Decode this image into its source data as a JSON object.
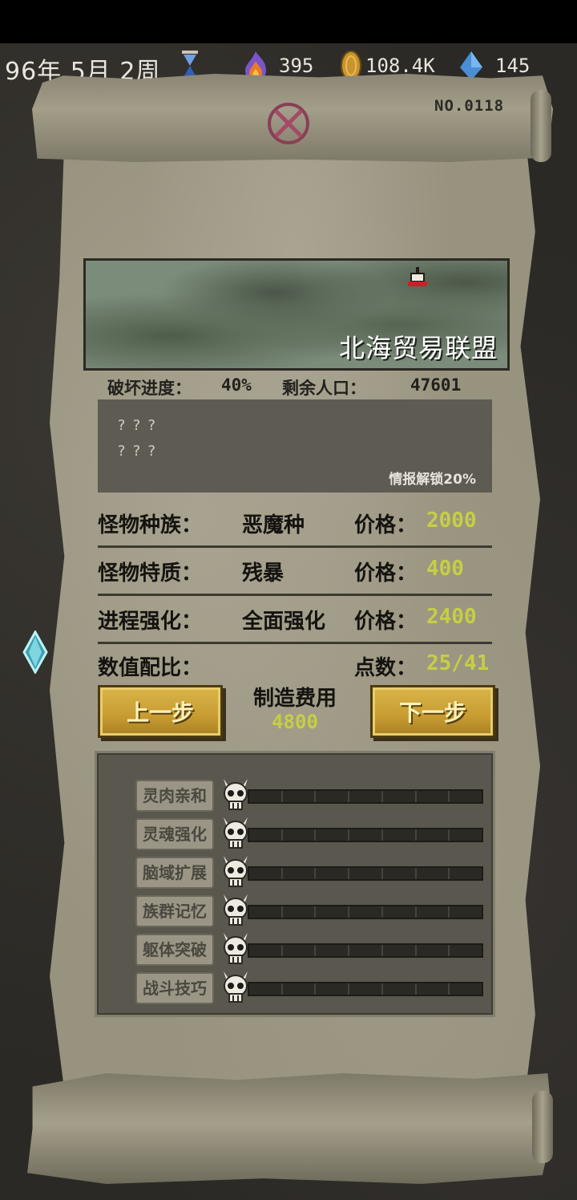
{
  "hud": {
    "date": "96年 5月 2周",
    "fire": "395",
    "coins": "108.4K",
    "crystals": "145"
  },
  "serial": "NO.0118",
  "map": {
    "region": "北海贸易联盟"
  },
  "progress": {
    "destroy_label": "破坏进度：",
    "destroy_value": "40%",
    "pop_label": "剩余人口：",
    "pop_value": "47601"
  },
  "intel": {
    "line1": "???",
    "line2": "???",
    "unlock": "情报解锁20%"
  },
  "rows": [
    {
      "label": "怪物种族：",
      "value": "恶魔种",
      "price_label": "价格：",
      "price": "2000"
    },
    {
      "label": "怪物特质：",
      "value": "残暴",
      "price_label": "价格：",
      "price": "400"
    },
    {
      "label": "进程强化：",
      "value": "全面强化",
      "price_label": "价格：",
      "price": "2400"
    },
    {
      "label": "数值配比：",
      "value": "",
      "price_label": "点数：",
      "price": "25/41"
    }
  ],
  "buttons": {
    "prev": "上一步",
    "next": "下一步"
  },
  "cost": {
    "label": "制造费用",
    "value": "4800"
  },
  "stats": [
    {
      "name": "灵肉亲和",
      "level": 0,
      "max": 7
    },
    {
      "name": "灵魂强化",
      "level": 0,
      "max": 7
    },
    {
      "name": "脑域扩展",
      "level": 0,
      "max": 7
    },
    {
      "name": "族群记忆",
      "level": 0,
      "max": 7
    },
    {
      "name": "躯体突破",
      "level": 0,
      "max": 7
    },
    {
      "name": "战斗技巧",
      "level": 0,
      "max": 7
    }
  ],
  "colors": {
    "price": "#c6cf43",
    "button": "#c89c32",
    "parchment": "#98937f"
  }
}
